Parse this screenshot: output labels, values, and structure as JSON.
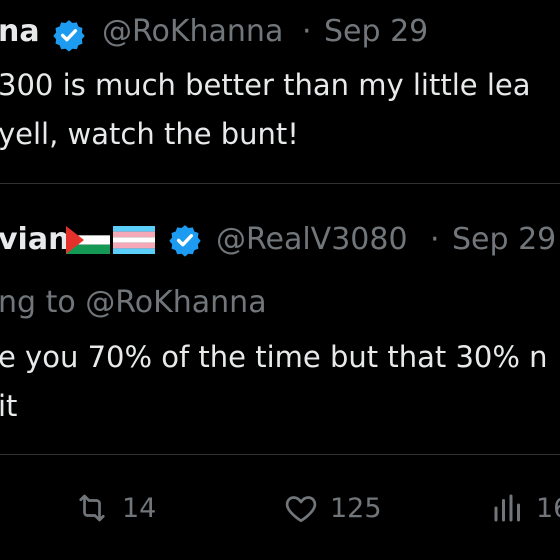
{
  "tweet": {
    "author_name_fragment": "na",
    "handle": "@RoKhanna",
    "separator": "·",
    "date": "Sep 29",
    "lines": [
      "300 is much better than my little lea",
      "yell, watch the bunt!"
    ]
  },
  "reply": {
    "author_name_fragment": "vian",
    "handle": "@RealV3080",
    "separator": "·",
    "date": "Sep 29",
    "replying_to": "ng to @RoKhanna",
    "lines": [
      "e you 70% of the time but that 30% n",
      "it"
    ]
  },
  "actions": {
    "retweet_count": "14",
    "like_count": "125",
    "views_count": "16"
  },
  "icons": {
    "verified": "verified-badge-icon",
    "retweet": "retweet-icon",
    "like": "heart-icon",
    "views": "views-chart-icon"
  },
  "colors": {
    "verified": "#1d9bf0",
    "muted": "#71767b",
    "text": "#e7e9ea"
  }
}
